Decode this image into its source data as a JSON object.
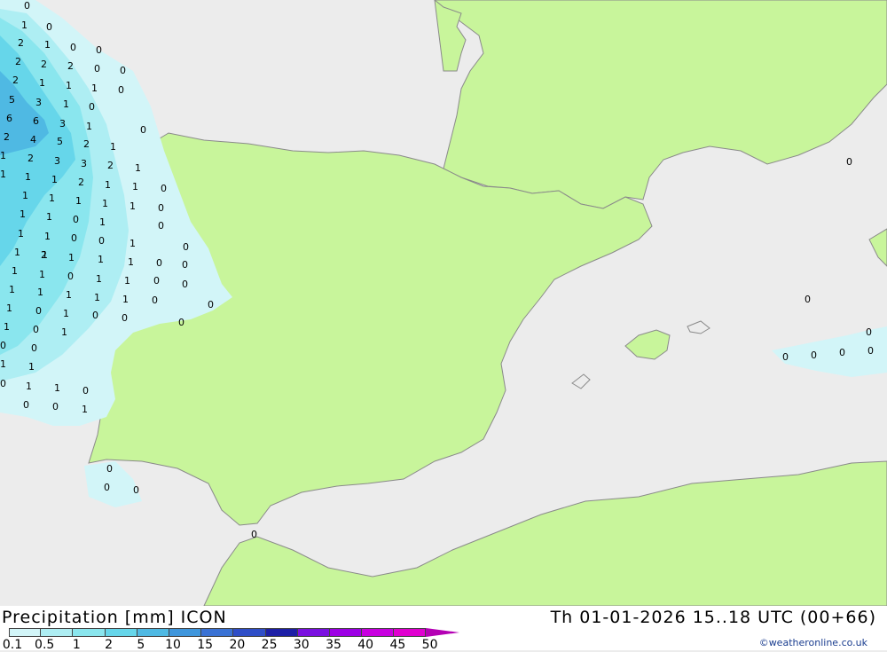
{
  "header": {
    "title": "Precipitation [mm] ICON",
    "datetime": "Th 01-01-2026 15..18 UTC (00+66)",
    "credit": "©weatheronline.co.uk"
  },
  "legend": {
    "labels": [
      "0.1",
      "0.5",
      "1",
      "2",
      "5",
      "10",
      "15",
      "20",
      "25",
      "30",
      "35",
      "40",
      "45",
      "50"
    ],
    "colors": [
      "#d2f5f8",
      "#aeeef3",
      "#8ae6ee",
      "#66d6ea",
      "#4fb9e3",
      "#3f96dc",
      "#3a72d4",
      "#2f4ec7",
      "#1d1fa6",
      "#7a10e0",
      "#9d00e5",
      "#c800e0",
      "#e000d0",
      "#b400b4"
    ]
  },
  "colors": {
    "sea": "#ececec",
    "land": "#c8f59b",
    "border": "#8a8a8a",
    "precip_light": "#d2f5f8",
    "precip_mid": "#8ae6ee",
    "precip_high": "#4fb9e3",
    "precip_max": "#3f96dc"
  },
  "precip_values": [
    {
      "v": "0"
    },
    {
      "v": "1"
    },
    {
      "v": "0"
    },
    {
      "v": "2"
    },
    {
      "v": "1"
    },
    {
      "v": "0"
    },
    {
      "v": "0"
    },
    {
      "v": "2"
    },
    {
      "v": "2"
    },
    {
      "v": "2"
    },
    {
      "v": "0"
    },
    {
      "v": "0"
    },
    {
      "v": "2"
    },
    {
      "v": "1"
    },
    {
      "v": "1"
    },
    {
      "v": "1"
    },
    {
      "v": "0"
    },
    {
      "v": "5"
    },
    {
      "v": "3"
    },
    {
      "v": "1"
    },
    {
      "v": "0"
    },
    {
      "v": "6"
    },
    {
      "v": "6"
    },
    {
      "v": "3"
    },
    {
      "v": "1"
    },
    {
      "v": "0"
    },
    {
      "v": "2"
    },
    {
      "v": "4"
    },
    {
      "v": "5"
    },
    {
      "v": "2"
    },
    {
      "v": "1"
    },
    {
      "v": "1"
    },
    {
      "v": "2"
    },
    {
      "v": "3"
    },
    {
      "v": "3"
    },
    {
      "v": "2"
    },
    {
      "v": "1"
    },
    {
      "v": "1"
    },
    {
      "v": "1"
    },
    {
      "v": "1"
    },
    {
      "v": "2"
    },
    {
      "v": "1"
    },
    {
      "v": "1"
    },
    {
      "v": "0"
    },
    {
      "v": "1"
    },
    {
      "v": "1"
    },
    {
      "v": "1"
    },
    {
      "v": "1"
    },
    {
      "v": "1"
    },
    {
      "v": "0"
    },
    {
      "v": "1"
    },
    {
      "v": "1"
    },
    {
      "v": "0"
    },
    {
      "v": "1"
    },
    {
      "v": "0"
    },
    {
      "v": "1"
    },
    {
      "v": "1"
    },
    {
      "v": "0"
    },
    {
      "v": "0"
    },
    {
      "v": "1"
    },
    {
      "v": "0"
    },
    {
      "v": "1"
    },
    {
      "v": "1"
    },
    {
      "v": "1"
    },
    {
      "v": "0"
    },
    {
      "v": "1"
    },
    {
      "v": "2"
    },
    {
      "v": "1"
    },
    {
      "v": "1"
    },
    {
      "v": "1"
    },
    {
      "v": "0"
    },
    {
      "v": "1"
    },
    {
      "v": "1"
    },
    {
      "v": "0"
    },
    {
      "v": "1"
    },
    {
      "v": "1"
    },
    {
      "v": "0"
    },
    {
      "v": "0"
    },
    {
      "v": "1"
    },
    {
      "v": "1"
    },
    {
      "v": "1"
    },
    {
      "v": "1"
    },
    {
      "v": "0"
    },
    {
      "v": "0"
    },
    {
      "v": "0"
    },
    {
      "v": "1"
    },
    {
      "v": "0"
    },
    {
      "v": "1"
    },
    {
      "v": "0"
    },
    {
      "v": "0"
    },
    {
      "v": "0"
    },
    {
      "v": "1"
    },
    {
      "v": "0"
    },
    {
      "v": "0"
    },
    {
      "v": "1"
    },
    {
      "v": "1"
    },
    {
      "v": "1"
    },
    {
      "v": "1"
    },
    {
      "v": "0"
    },
    {
      "v": "0"
    },
    {
      "v": "0"
    },
    {
      "v": "0"
    },
    {
      "v": "1"
    },
    {
      "v": "0"
    },
    {
      "v": "0"
    },
    {
      "v": "0"
    },
    {
      "v": "0"
    },
    {
      "v": "0"
    },
    {
      "v": "0"
    },
    {
      "v": "0"
    },
    {
      "v": "0"
    },
    {
      "v": "0"
    },
    {
      "v": "0"
    },
    {
      "v": "0"
    },
    {
      "v": "1"
    },
    {
      "v": "0"
    }
  ]
}
